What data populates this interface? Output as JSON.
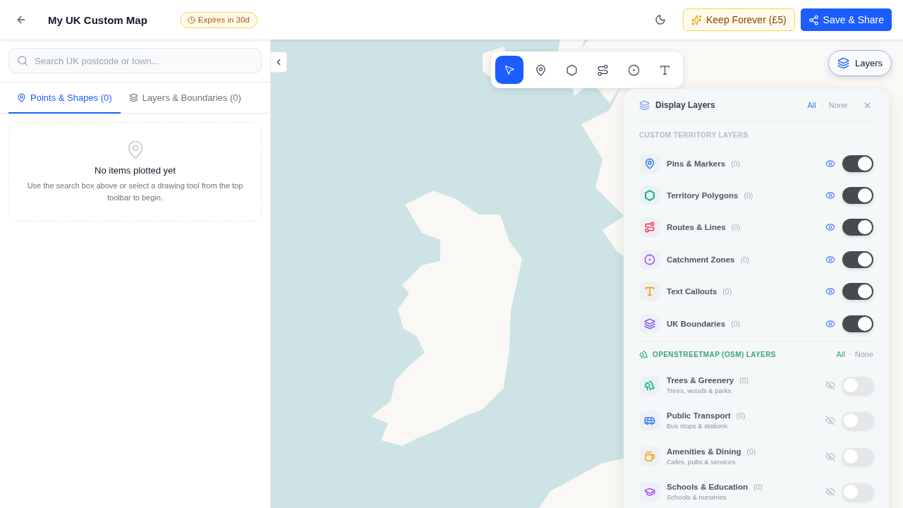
{
  "header": {
    "title": "My UK Custom Map",
    "expiry": "Expires in 30d",
    "keep_forever": "Keep Forever (£5)",
    "save_share": "Save & Share"
  },
  "sidebar": {
    "search": {
      "placeholder": "Search UK postcode or town..."
    },
    "tabs": [
      {
        "label": "Points & Shapes (0)",
        "kind": "pin",
        "selected": true
      },
      {
        "label": "Layers & Boundaries (0)",
        "kind": "layers",
        "selected": false
      }
    ],
    "empty_state": {
      "title": "No items plotted yet",
      "text": "Use the search box above or select a drawing tool from the top toolbar to begin."
    }
  },
  "map": {
    "kind": "picture",
    "tools": [
      {
        "kind": "select",
        "selected": true
      },
      {
        "kind": "pin",
        "selected": false
      },
      {
        "kind": "polygon",
        "selected": false
      },
      {
        "kind": "route",
        "selected": false
      },
      {
        "kind": "circle",
        "selected": false
      },
      {
        "kind": "text",
        "selected": false
      }
    ],
    "layers_button": "Layers"
  },
  "layers_panel": {
    "title": "Display Layers",
    "all": "All",
    "none": "None",
    "sections": [
      {
        "title": "CUSTOM TERRITORY LAYERS",
        "kind": "custom",
        "layers": [
          {
            "name": "Pins & Markers",
            "count": "(0)",
            "kind": "pin",
            "color": "#3b82f6",
            "visible": true,
            "on": true
          },
          {
            "name": "Territory Polygons",
            "count": "(0)",
            "kind": "polygon",
            "color": "#10b981",
            "visible": true,
            "on": true
          },
          {
            "name": "Routes & Lines",
            "count": "(0)",
            "kind": "route",
            "color": "#f43f5e",
            "visible": true,
            "on": true
          },
          {
            "name": "Catchment Zones",
            "count": "(0)",
            "kind": "circle",
            "color": "#a855f7",
            "visible": true,
            "on": true
          },
          {
            "name": "Text Callouts",
            "count": "(0)",
            "kind": "text",
            "color": "#f59e0b",
            "visible": true,
            "on": true
          },
          {
            "name": "UK Boundaries",
            "count": "(0)",
            "kind": "layers",
            "color": "#8b5cf6",
            "visible": true,
            "on": true
          }
        ]
      },
      {
        "title": "OPENSTREETMAP (OSM) LAYERS",
        "kind": "osm",
        "all": "All",
        "none": "None",
        "layers": [
          {
            "name": "Trees & Greenery",
            "count": "(0)",
            "subtitle": "Trees, woods & parks",
            "kind": "trees",
            "color": "#10b981",
            "visible": false,
            "on": false
          },
          {
            "name": "Public Transport",
            "count": "(0)",
            "subtitle": "Bus stops & stations",
            "kind": "bus",
            "color": "#3b82f6",
            "visible": false,
            "on": false
          },
          {
            "name": "Amenities & Dining",
            "count": "(0)",
            "subtitle": "Cafes, pubs & services",
            "kind": "coffee",
            "color": "#f59e0b",
            "visible": false,
            "on": false
          },
          {
            "name": "Schools & Education",
            "count": "(0)",
            "subtitle": "Schools & nurseries",
            "kind": "school",
            "color": "#a855f7",
            "visible": false,
            "on": false
          }
        ]
      }
    ]
  }
}
